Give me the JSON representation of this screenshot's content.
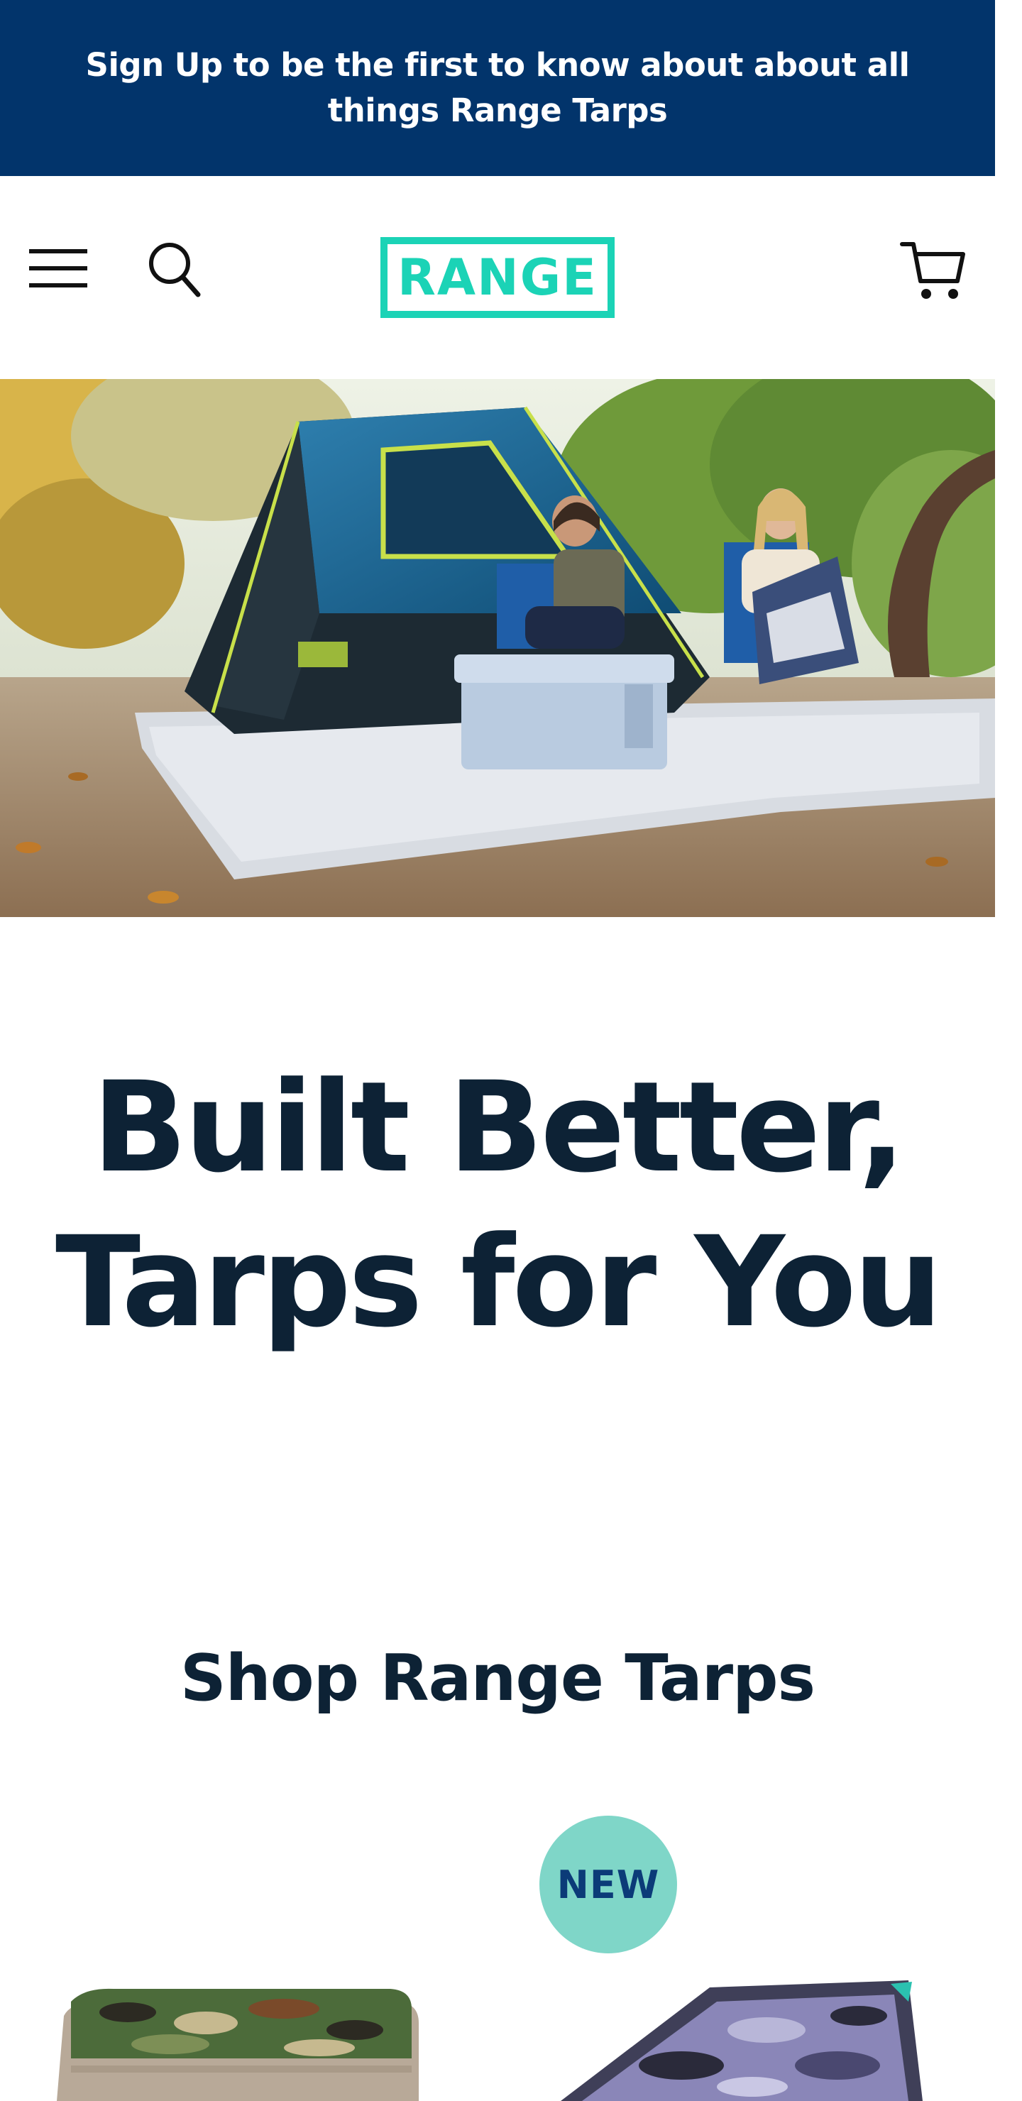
{
  "announcement": {
    "text": "Sign Up to be the first to know about about all things Range Tarps"
  },
  "header": {
    "logo_text": "RANGE",
    "menu_icon": "hamburger-menu-icon",
    "search_icon": "search-icon",
    "cart_icon": "cart-icon"
  },
  "hero": {
    "image": "camping-scene-tent-tarp"
  },
  "headline": {
    "line1": "Built Better,",
    "line2": "Tarps for You"
  },
  "shop": {
    "title": "Shop Range Tarps",
    "products": [
      {
        "image": "folded-camo-tarp-green"
      },
      {
        "image": "folded-camo-tarp-purple",
        "badge": "NEW"
      }
    ]
  },
  "colors": {
    "announcement_bg": "#02346b",
    "logo_accent": "#1bd3b6",
    "heading_text": "#0d2235",
    "badge_bg": "#7fd6c8",
    "badge_text": "#0b3b78"
  }
}
